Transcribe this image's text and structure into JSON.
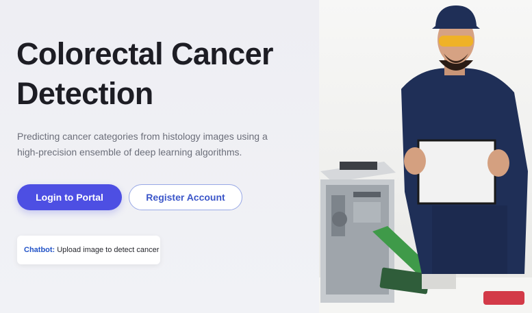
{
  "hero": {
    "title": "Colorectal Cancer Detection",
    "subtitle": "Predicting cancer categories from histology images using a high-precision ensemble of deep learning algorithms."
  },
  "buttons": {
    "login_label": "Login to Portal",
    "register_label": "Register Account"
  },
  "chatbot": {
    "label": "Chatbot:",
    "text": "Upload image to detect cancer"
  },
  "colors": {
    "primary": "#4d4fe3",
    "link": "#2253c7",
    "title": "#1d1d24",
    "background": "#eeeef3"
  }
}
